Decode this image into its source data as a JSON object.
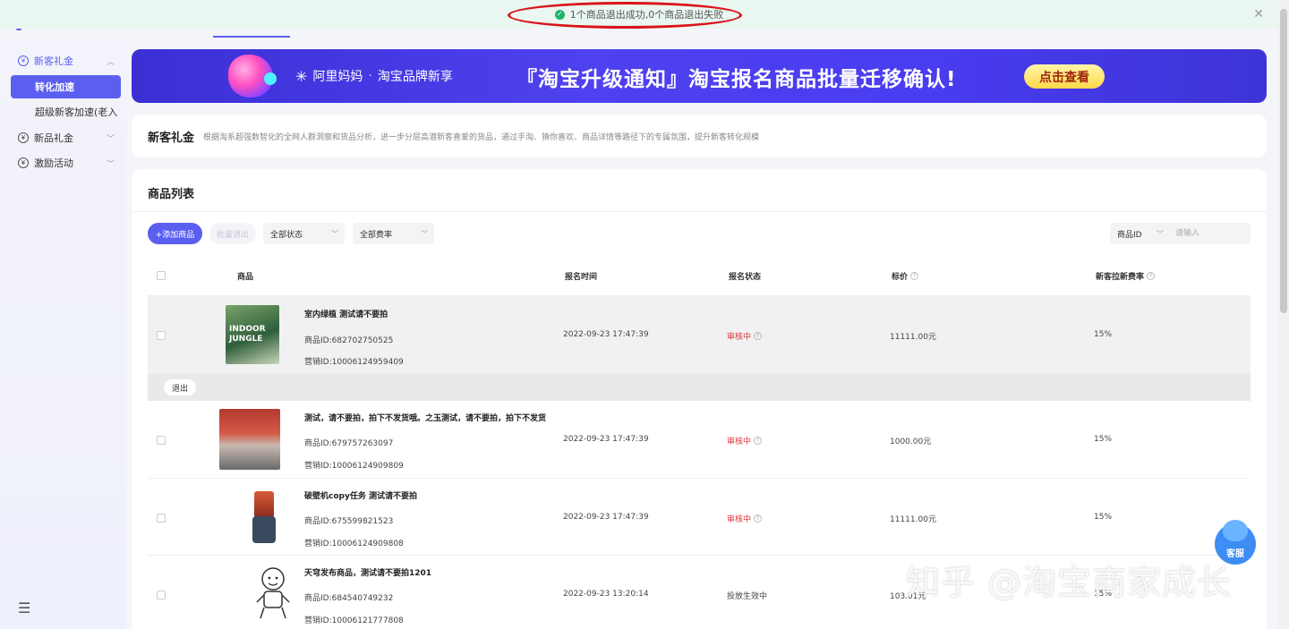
{
  "toast": {
    "message": "1个商品退出成功,0个商品退出失败"
  },
  "sidebar": {
    "groups": [
      {
        "label": "新客礼金",
        "expanded": true,
        "children": [
          {
            "label": "转化加速",
            "active": true
          },
          {
            "label": "超级新客加速(老入"
          }
        ]
      },
      {
        "label": "新品礼金",
        "expanded": false
      },
      {
        "label": "激励活动",
        "expanded": false
      }
    ]
  },
  "banner": {
    "brand": "阿里妈妈",
    "sep": "·",
    "sub_brand": "淘宝品牌新享",
    "headline": "『淘宝升级通知』淘宝报名商品批量迁移确认!",
    "cta": "点击查看"
  },
  "intro": {
    "title": "新客礼金",
    "desc": "根据淘系超强数智化的全网人群洞察和货品分析，进一步分层高潜新客喜爱的货品，通过手淘、猜你喜欢、商品详情等路径下的专属氛围，提升新客转化规模"
  },
  "list": {
    "title": "商品列表",
    "add_button": "+添加商品",
    "batch_button": "批量退出",
    "status_select": "全部状态",
    "rate_select": "全部费率",
    "search_field": "商品ID",
    "search_placeholder": "请输入",
    "quit_button": "退出",
    "columns": [
      "商品",
      "报名时间",
      "报名状态",
      "标价",
      "新客拉新费率"
    ],
    "rows": [
      {
        "name": "室内绿植 测试请不要拍",
        "product_id": "商品ID:682702750525",
        "marketing_id": "营销ID:10006124959409",
        "time": "2022-09-23 17:47:39",
        "status": "审核中",
        "price": "11111.00元",
        "rate": "15%"
      },
      {
        "name": "测试，请不要拍，拍下不发货哦。之玉测试，请不要拍，拍下不发货",
        "product_id": "商品ID:679757263097",
        "marketing_id": "营销ID:10006124909809",
        "time": "2022-09-23 17:47:39",
        "status": "审核中",
        "price": "1000.00元",
        "rate": "15%"
      },
      {
        "name": "破壁机copy任务 测试请不要拍",
        "product_id": "商品ID:675599821523",
        "marketing_id": "营销ID:10006124909808",
        "time": "2022-09-23 17:47:39",
        "status": "审核中",
        "price": "11111.00元",
        "rate": "15%"
      },
      {
        "name": "天穹发布商品，测试请不要拍1201",
        "product_id": "商品ID:684540749232",
        "marketing_id": "营销ID:10006121777808",
        "time": "2022-09-23 13:20:14",
        "status": "投放生效中",
        "price": "103.01元",
        "rate": "15%"
      }
    ]
  },
  "thumb1_text": "INDOOR JUNGLE",
  "customer_service": "客服",
  "watermark": "知乎 @淘宝商家成长",
  "colors": {
    "accent": "#5b5ff0",
    "status_red": "#e2343b",
    "toast_bg": "#eaf7f1",
    "success": "#20b26b"
  }
}
